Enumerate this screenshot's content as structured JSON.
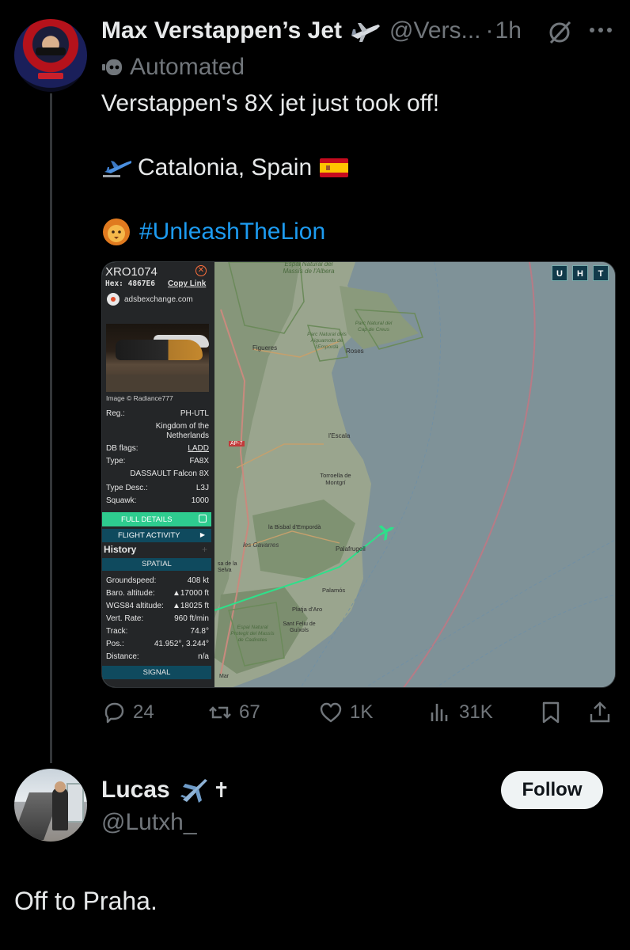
{
  "tweet1": {
    "name": "Max Verstappen’s Jet",
    "handle": "@Vers...",
    "separator": "·",
    "time": "1h",
    "automated_label": "Automated",
    "text_line1": "Verstappen's 8X jet just took off!",
    "location": "Catalonia, Spain",
    "hashtag": "#UnleashTheLion",
    "icons": [
      "jet-icon",
      "grok-icon",
      "more-icon",
      "bot-icon",
      "plane-emoji",
      "spain-flag",
      "lion-emoji"
    ],
    "media": {
      "panel": {
        "callsign": "XRO1074",
        "hex_label": "Hex: 4867E6",
        "copy_link": "Copy Link",
        "source": "adsbexchange.com",
        "image_credit": "Image © Radiance777",
        "reg_label": "Reg.:",
        "reg_value": "PH-UTL",
        "country_line1": "Kingdom of the",
        "country_line2": "Netherlands",
        "db_flags_label": "DB flags:",
        "db_flags_value": "LADD",
        "type_label": "Type:",
        "type_value": "FA8X",
        "type_full": "DASSAULT Falcon 8X",
        "type_desc_label": "Type Desc.:",
        "type_desc_value": "L3J",
        "squawk_label": "Squawk:",
        "squawk_value": "1000",
        "full_details": "FULL DETAILS",
        "flight_activity": "FLIGHT ACTIVITY",
        "history": "History",
        "spatial": "SPATIAL",
        "groundspeed_label": "Groundspeed:",
        "groundspeed_value": "408 kt",
        "baro_label": "Baro. altitude:",
        "baro_value": "▲17000 ft",
        "wgs_label": "WGS84 altitude:",
        "wgs_value": "▲18025 ft",
        "vert_label": "Vert. Rate:",
        "vert_value": "960 ft/min",
        "track_label": "Track:",
        "track_value": "74.8°",
        "pos_label": "Pos.:",
        "pos_value": "41.952°, 3.244°",
        "distance_label": "Distance:",
        "distance_value": "n/a",
        "signal": "SIGNAL"
      },
      "map_labels": {
        "park1": "Espai Natural del Massís de l'Albera",
        "park2": "Parc Natural del Cap de Creus",
        "park3": "Parc Natural dels Aiguamolls de l'Empordà",
        "figueres": "Figueres",
        "roses": "Roses",
        "road": "AP-7",
        "lescala": "l'Escala",
        "torroella": "Torroella de Montgrí",
        "bisbal": "la Bisbal d'Empordà",
        "gavarres": "les Gavarres",
        "palafrugell": "Palafrugell",
        "palamos": "Palamós",
        "platja": "Platja d'Aro",
        "guixols": "Sant Feliu de Guíxols",
        "park4": "Espai Natural Protegit del Massís de Cadiretes",
        "selva": "sa de la Selva",
        "mar": "Mar"
      },
      "uht": [
        "U",
        "H",
        "T"
      ]
    },
    "actions": {
      "replies": "24",
      "reposts": "67",
      "likes": "1K",
      "views": "31K"
    }
  },
  "tweet2": {
    "name": "Lucas",
    "cross": "✝",
    "handle": "@Lutxh_",
    "follow_label": "Follow",
    "text": "Off to Praha."
  },
  "colors": {
    "background": "#000000",
    "text": "#e7e9ea",
    "muted": "#71767b",
    "accent": "#1d9bf0",
    "adsb_green": "#2ecc8f"
  }
}
